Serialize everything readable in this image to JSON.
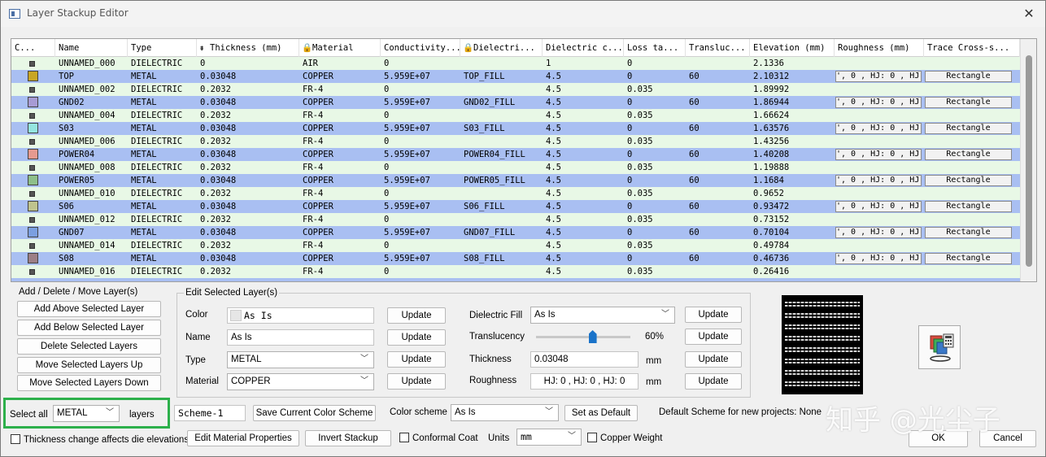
{
  "window": {
    "title": "Layer Stackup Editor",
    "close_glyph": "✕"
  },
  "grid": {
    "headers": [
      "C...",
      "Name",
      "Type",
      "Thickness (mm)",
      "Material",
      "Conductivity...",
      "Dielectri...",
      "Dielectric c...",
      "Loss ta...",
      "Transluc...",
      "Elevation (mm)",
      "Roughness (mm)",
      "Trace Cross-s..."
    ],
    "rows": [
      {
        "color": "",
        "name": "UNNAMED_000",
        "type": "DIELECTRIC",
        "thickness": "0",
        "material": "AIR",
        "conductivity": "0",
        "dielectric": "",
        "dk": "1",
        "loss": "0",
        "transluc": "",
        "elevation": "2.1336",
        "roughness": "",
        "trace": ""
      },
      {
        "color": "#c8a626",
        "name": "TOP",
        "type": "METAL",
        "thickness": "0.03048",
        "material": "COPPER",
        "conductivity": "5.959E+07",
        "dielectric": "TOP_FILL",
        "dk": "4.5",
        "loss": "0",
        "transluc": "60",
        "elevation": "2.10312",
        "roughness": "', 0 , HJ: 0 , HJ:",
        "trace": "Rectangle"
      },
      {
        "color": "",
        "name": "UNNAMED_002",
        "type": "DIELECTRIC",
        "thickness": "0.2032",
        "material": "FR-4",
        "conductivity": "0",
        "dielectric": "",
        "dk": "4.5",
        "loss": "0.035",
        "transluc": "",
        "elevation": "1.89992",
        "roughness": "",
        "trace": ""
      },
      {
        "color": "#a79bd4",
        "name": "GND02",
        "type": "METAL",
        "thickness": "0.03048",
        "material": "COPPER",
        "conductivity": "5.959E+07",
        "dielectric": "GND02_FILL",
        "dk": "4.5",
        "loss": "0",
        "transluc": "60",
        "elevation": "1.86944",
        "roughness": "', 0 , HJ: 0 , HJ:",
        "trace": "Rectangle"
      },
      {
        "color": "",
        "name": "UNNAMED_004",
        "type": "DIELECTRIC",
        "thickness": "0.2032",
        "material": "FR-4",
        "conductivity": "0",
        "dielectric": "",
        "dk": "4.5",
        "loss": "0.035",
        "transluc": "",
        "elevation": "1.66624",
        "roughness": "",
        "trace": ""
      },
      {
        "color": "#94e6e0",
        "name": "S03",
        "type": "METAL",
        "thickness": "0.03048",
        "material": "COPPER",
        "conductivity": "5.959E+07",
        "dielectric": "S03_FILL",
        "dk": "4.5",
        "loss": "0",
        "transluc": "60",
        "elevation": "1.63576",
        "roughness": "', 0 , HJ: 0 , HJ:",
        "trace": "Rectangle"
      },
      {
        "color": "",
        "name": "UNNAMED_006",
        "type": "DIELECTRIC",
        "thickness": "0.2032",
        "material": "FR-4",
        "conductivity": "0",
        "dielectric": "",
        "dk": "4.5",
        "loss": "0.035",
        "transluc": "",
        "elevation": "1.43256",
        "roughness": "",
        "trace": ""
      },
      {
        "color": "#e59a90",
        "name": "POWER04",
        "type": "METAL",
        "thickness": "0.03048",
        "material": "COPPER",
        "conductivity": "5.959E+07",
        "dielectric": "POWER04_FILL",
        "dk": "4.5",
        "loss": "0",
        "transluc": "60",
        "elevation": "1.40208",
        "roughness": "', 0 , HJ: 0 , HJ:",
        "trace": "Rectangle"
      },
      {
        "color": "",
        "name": "UNNAMED_008",
        "type": "DIELECTRIC",
        "thickness": "0.2032",
        "material": "FR-4",
        "conductivity": "0",
        "dielectric": "",
        "dk": "4.5",
        "loss": "0.035",
        "transluc": "",
        "elevation": "1.19888",
        "roughness": "",
        "trace": ""
      },
      {
        "color": "#8dbf8a",
        "name": "POWER05",
        "type": "METAL",
        "thickness": "0.03048",
        "material": "COPPER",
        "conductivity": "5.959E+07",
        "dielectric": "POWER05_FILL",
        "dk": "4.5",
        "loss": "0",
        "transluc": "60",
        "elevation": "1.1684",
        "roughness": "', 0 , HJ: 0 , HJ:",
        "trace": "Rectangle"
      },
      {
        "color": "",
        "name": "UNNAMED_010",
        "type": "DIELECTRIC",
        "thickness": "0.2032",
        "material": "FR-4",
        "conductivity": "0",
        "dielectric": "",
        "dk": "4.5",
        "loss": "0.035",
        "transluc": "",
        "elevation": "0.9652",
        "roughness": "",
        "trace": ""
      },
      {
        "color": "#bfc38e",
        "name": "S06",
        "type": "METAL",
        "thickness": "0.03048",
        "material": "COPPER",
        "conductivity": "5.959E+07",
        "dielectric": "S06_FILL",
        "dk": "4.5",
        "loss": "0",
        "transluc": "60",
        "elevation": "0.93472",
        "roughness": "', 0 , HJ: 0 , HJ:",
        "trace": "Rectangle"
      },
      {
        "color": "",
        "name": "UNNAMED_012",
        "type": "DIELECTRIC",
        "thickness": "0.2032",
        "material": "FR-4",
        "conductivity": "0",
        "dielectric": "",
        "dk": "4.5",
        "loss": "0.035",
        "transluc": "",
        "elevation": "0.73152",
        "roughness": "",
        "trace": ""
      },
      {
        "color": "#7b9fe0",
        "name": "GND07",
        "type": "METAL",
        "thickness": "0.03048",
        "material": "COPPER",
        "conductivity": "5.959E+07",
        "dielectric": "GND07_FILL",
        "dk": "4.5",
        "loss": "0",
        "transluc": "60",
        "elevation": "0.70104",
        "roughness": "', 0 , HJ: 0 , HJ:",
        "trace": "Rectangle"
      },
      {
        "color": "",
        "name": "UNNAMED_014",
        "type": "DIELECTRIC",
        "thickness": "0.2032",
        "material": "FR-4",
        "conductivity": "0",
        "dielectric": "",
        "dk": "4.5",
        "loss": "0.035",
        "transluc": "",
        "elevation": "0.49784",
        "roughness": "",
        "trace": ""
      },
      {
        "color": "#9c7f86",
        "name": "S08",
        "type": "METAL",
        "thickness": "0.03048",
        "material": "COPPER",
        "conductivity": "5.959E+07",
        "dielectric": "S08_FILL",
        "dk": "4.5",
        "loss": "0",
        "transluc": "60",
        "elevation": "0.46736",
        "roughness": "', 0 , HJ: 0 , HJ:",
        "trace": "Rectangle"
      },
      {
        "color": "",
        "name": "UNNAMED_016",
        "type": "DIELECTRIC",
        "thickness": "0.2032",
        "material": "FR-4",
        "conductivity": "0",
        "dielectric": "",
        "dk": "4.5",
        "loss": "0.035",
        "transluc": "",
        "elevation": "0.26416",
        "roughness": "",
        "trace": ""
      }
    ]
  },
  "add_delete_move": {
    "legend": "Add / Delete / Move Layer(s)",
    "buttons": [
      "Add Above Selected Layer",
      "Add Below Selected Layer",
      "Delete Selected Layers",
      "Move Selected Layers Up",
      "Move Selected Layers Down"
    ]
  },
  "edit_selected": {
    "legend": "Edit Selected Layer(s)",
    "color_label": "Color",
    "color_value": "As Is",
    "name_label": "Name",
    "name_value": "As Is",
    "type_label": "Type",
    "type_value": "METAL",
    "material_label": "Material",
    "material_value": "COPPER",
    "update_label": "Update",
    "dielectric_fill_label": "Dielectric Fill",
    "dielectric_fill_value": "As Is",
    "translucency_label": "Translucency",
    "translucency_text": "60%",
    "translucency_value": 60,
    "thickness_label": "Thickness",
    "thickness_value": "0.03048",
    "thickness_unit": "mm",
    "roughness_label": "Roughness",
    "roughness_value": "HJ: 0 , HJ: 0 , HJ: 0",
    "roughness_unit": "mm"
  },
  "select_all": {
    "label": "Select all",
    "value": "METAL",
    "suffix": "layers"
  },
  "scheme": {
    "name_value": "Scheme-1",
    "save_label": "Save Current Color Scheme",
    "color_scheme_label": "Color scheme",
    "color_scheme_value": "As Is",
    "set_default_label": "Set as Default",
    "default_text": "Default Scheme for new projects: None"
  },
  "bottom": {
    "thickness_check_label": "Thickness change affects die elevations",
    "edit_material_label": "Edit Material Properties",
    "invert_label": "Invert Stackup",
    "conformal_label": "Conformal Coat",
    "units_label": "Units",
    "units_value": "mm",
    "copper_weight_label": "Copper Weight",
    "ok_label": "OK",
    "cancel_label": "Cancel"
  },
  "watermark": "知乎 @光尘子",
  "colors": {
    "metal_row": "#a9bff2",
    "dielectric_row": "#e8f8e6",
    "highlight_box": "#2db04b"
  }
}
